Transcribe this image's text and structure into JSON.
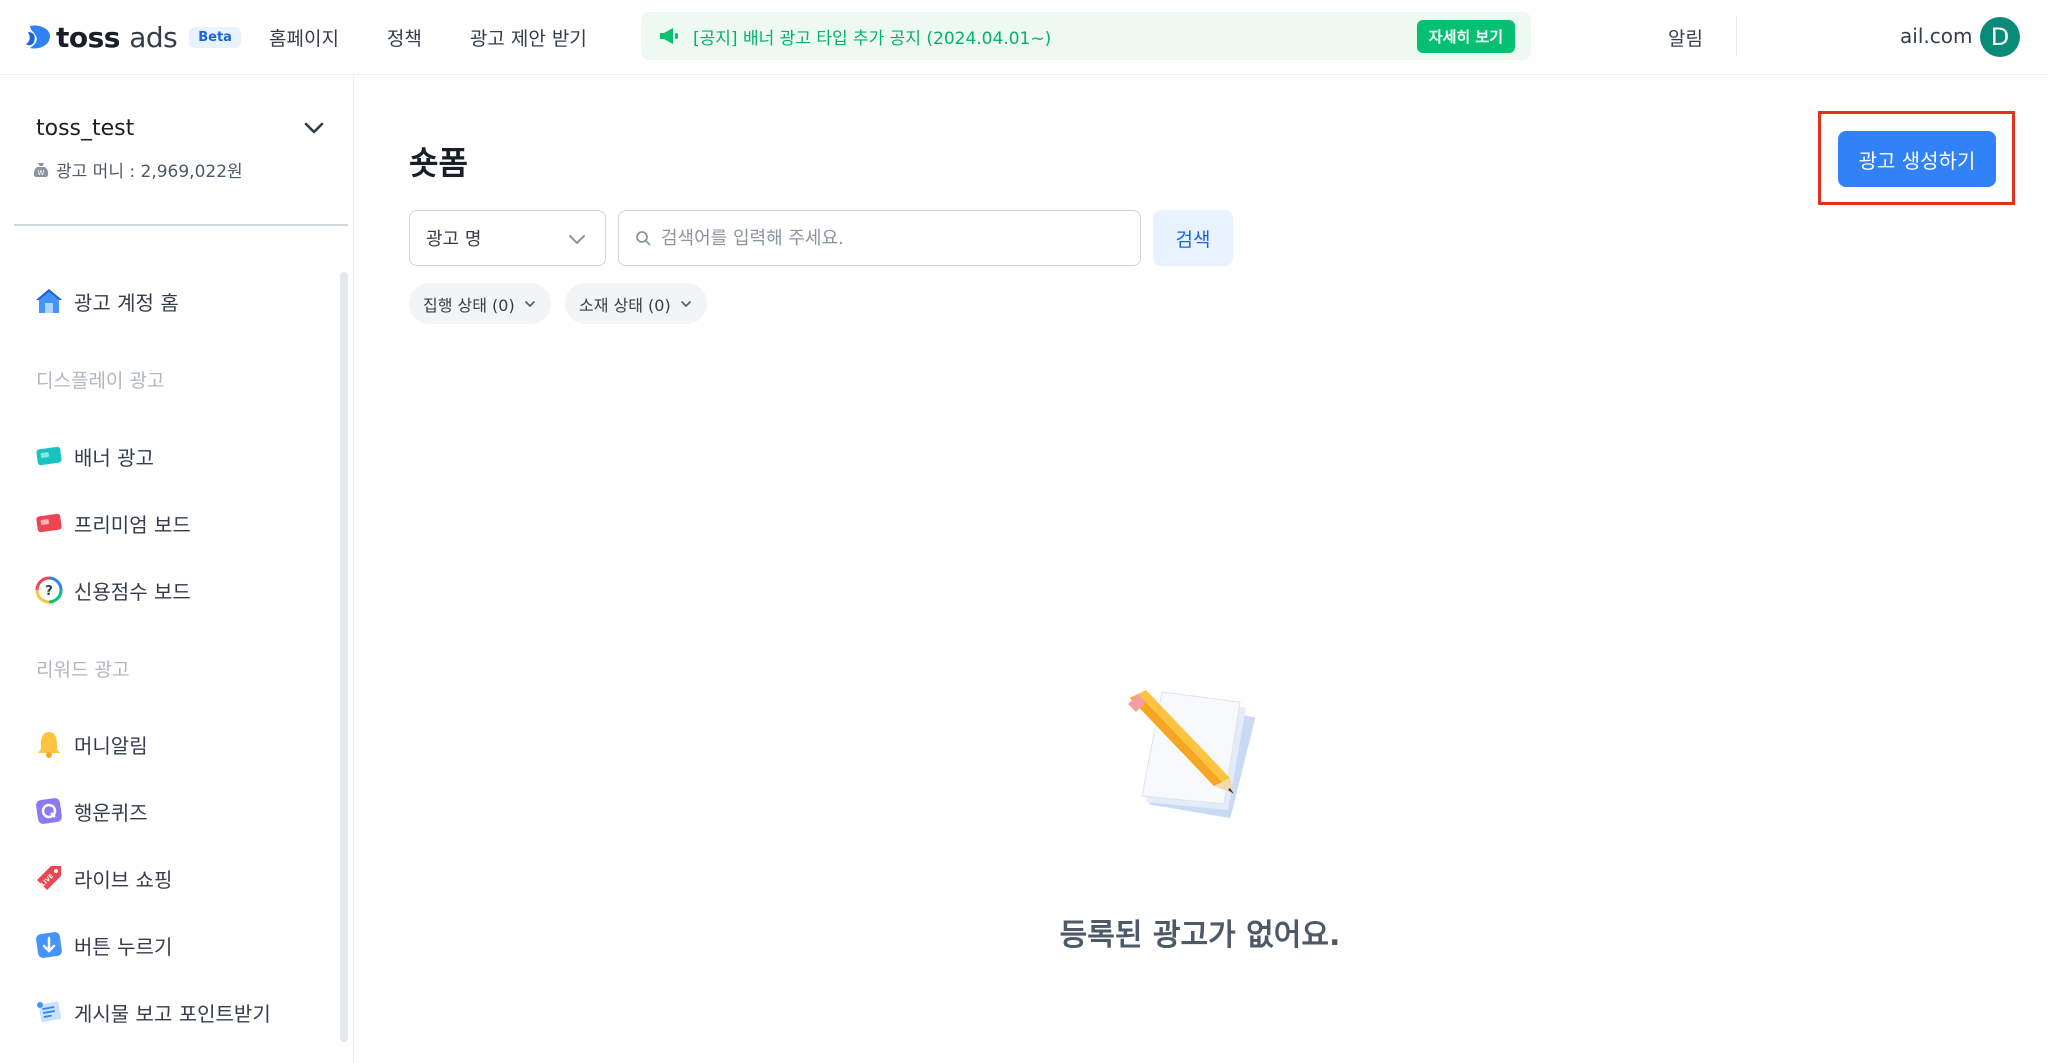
{
  "header": {
    "logo_text": "toss",
    "logo_suffix": "ads",
    "beta_badge": "Beta",
    "nav": [
      {
        "label": "홈페이지"
      },
      {
        "label": "정책"
      },
      {
        "label": "광고 제안 받기"
      }
    ],
    "notice_text": "[공지] 배너 광고 타입 추가 공지 (2024.04.01~)",
    "notice_button": "자세히 보기",
    "alarm_label": "알림",
    "email_text": "ail.com",
    "avatar_initial": "D",
    "colors": {
      "brand": "#3182f6",
      "notice_green": "#03b26c",
      "avatar": "#0a8a78"
    }
  },
  "sidebar": {
    "account_name": "toss_test",
    "money_label": "광고 머니 : 2,969,022원",
    "home_label": "광고 계정 홈",
    "display_section": "디스플레이 광고",
    "display_items": [
      {
        "label": "배너 광고",
        "icon": "banner-card-icon"
      },
      {
        "label": "프리미엄 보드",
        "icon": "premium-board-icon"
      },
      {
        "label": "신용점수 보드",
        "icon": "credit-score-icon"
      }
    ],
    "reward_section": "리워드 광고",
    "reward_items": [
      {
        "label": "머니알림",
        "icon": "bell-icon"
      },
      {
        "label": "행운퀴즈",
        "icon": "quiz-icon"
      },
      {
        "label": "라이브 쇼핑",
        "icon": "live-tag-icon"
      },
      {
        "label": "버튼 누르기",
        "icon": "press-button-icon"
      },
      {
        "label": "게시물 보고 포인트받기",
        "icon": "scroll-doc-icon"
      }
    ]
  },
  "main": {
    "title": "숏폼",
    "create_button": "광고 생성하기",
    "filter_select": "광고 명",
    "search_placeholder": "검색어를 입력해 주세요.",
    "search_button": "검색",
    "chips": [
      {
        "label": "집행 상태 (0)"
      },
      {
        "label": "소재 상태 (0)"
      }
    ],
    "empty_message": "등록된 광고가 없어요."
  }
}
